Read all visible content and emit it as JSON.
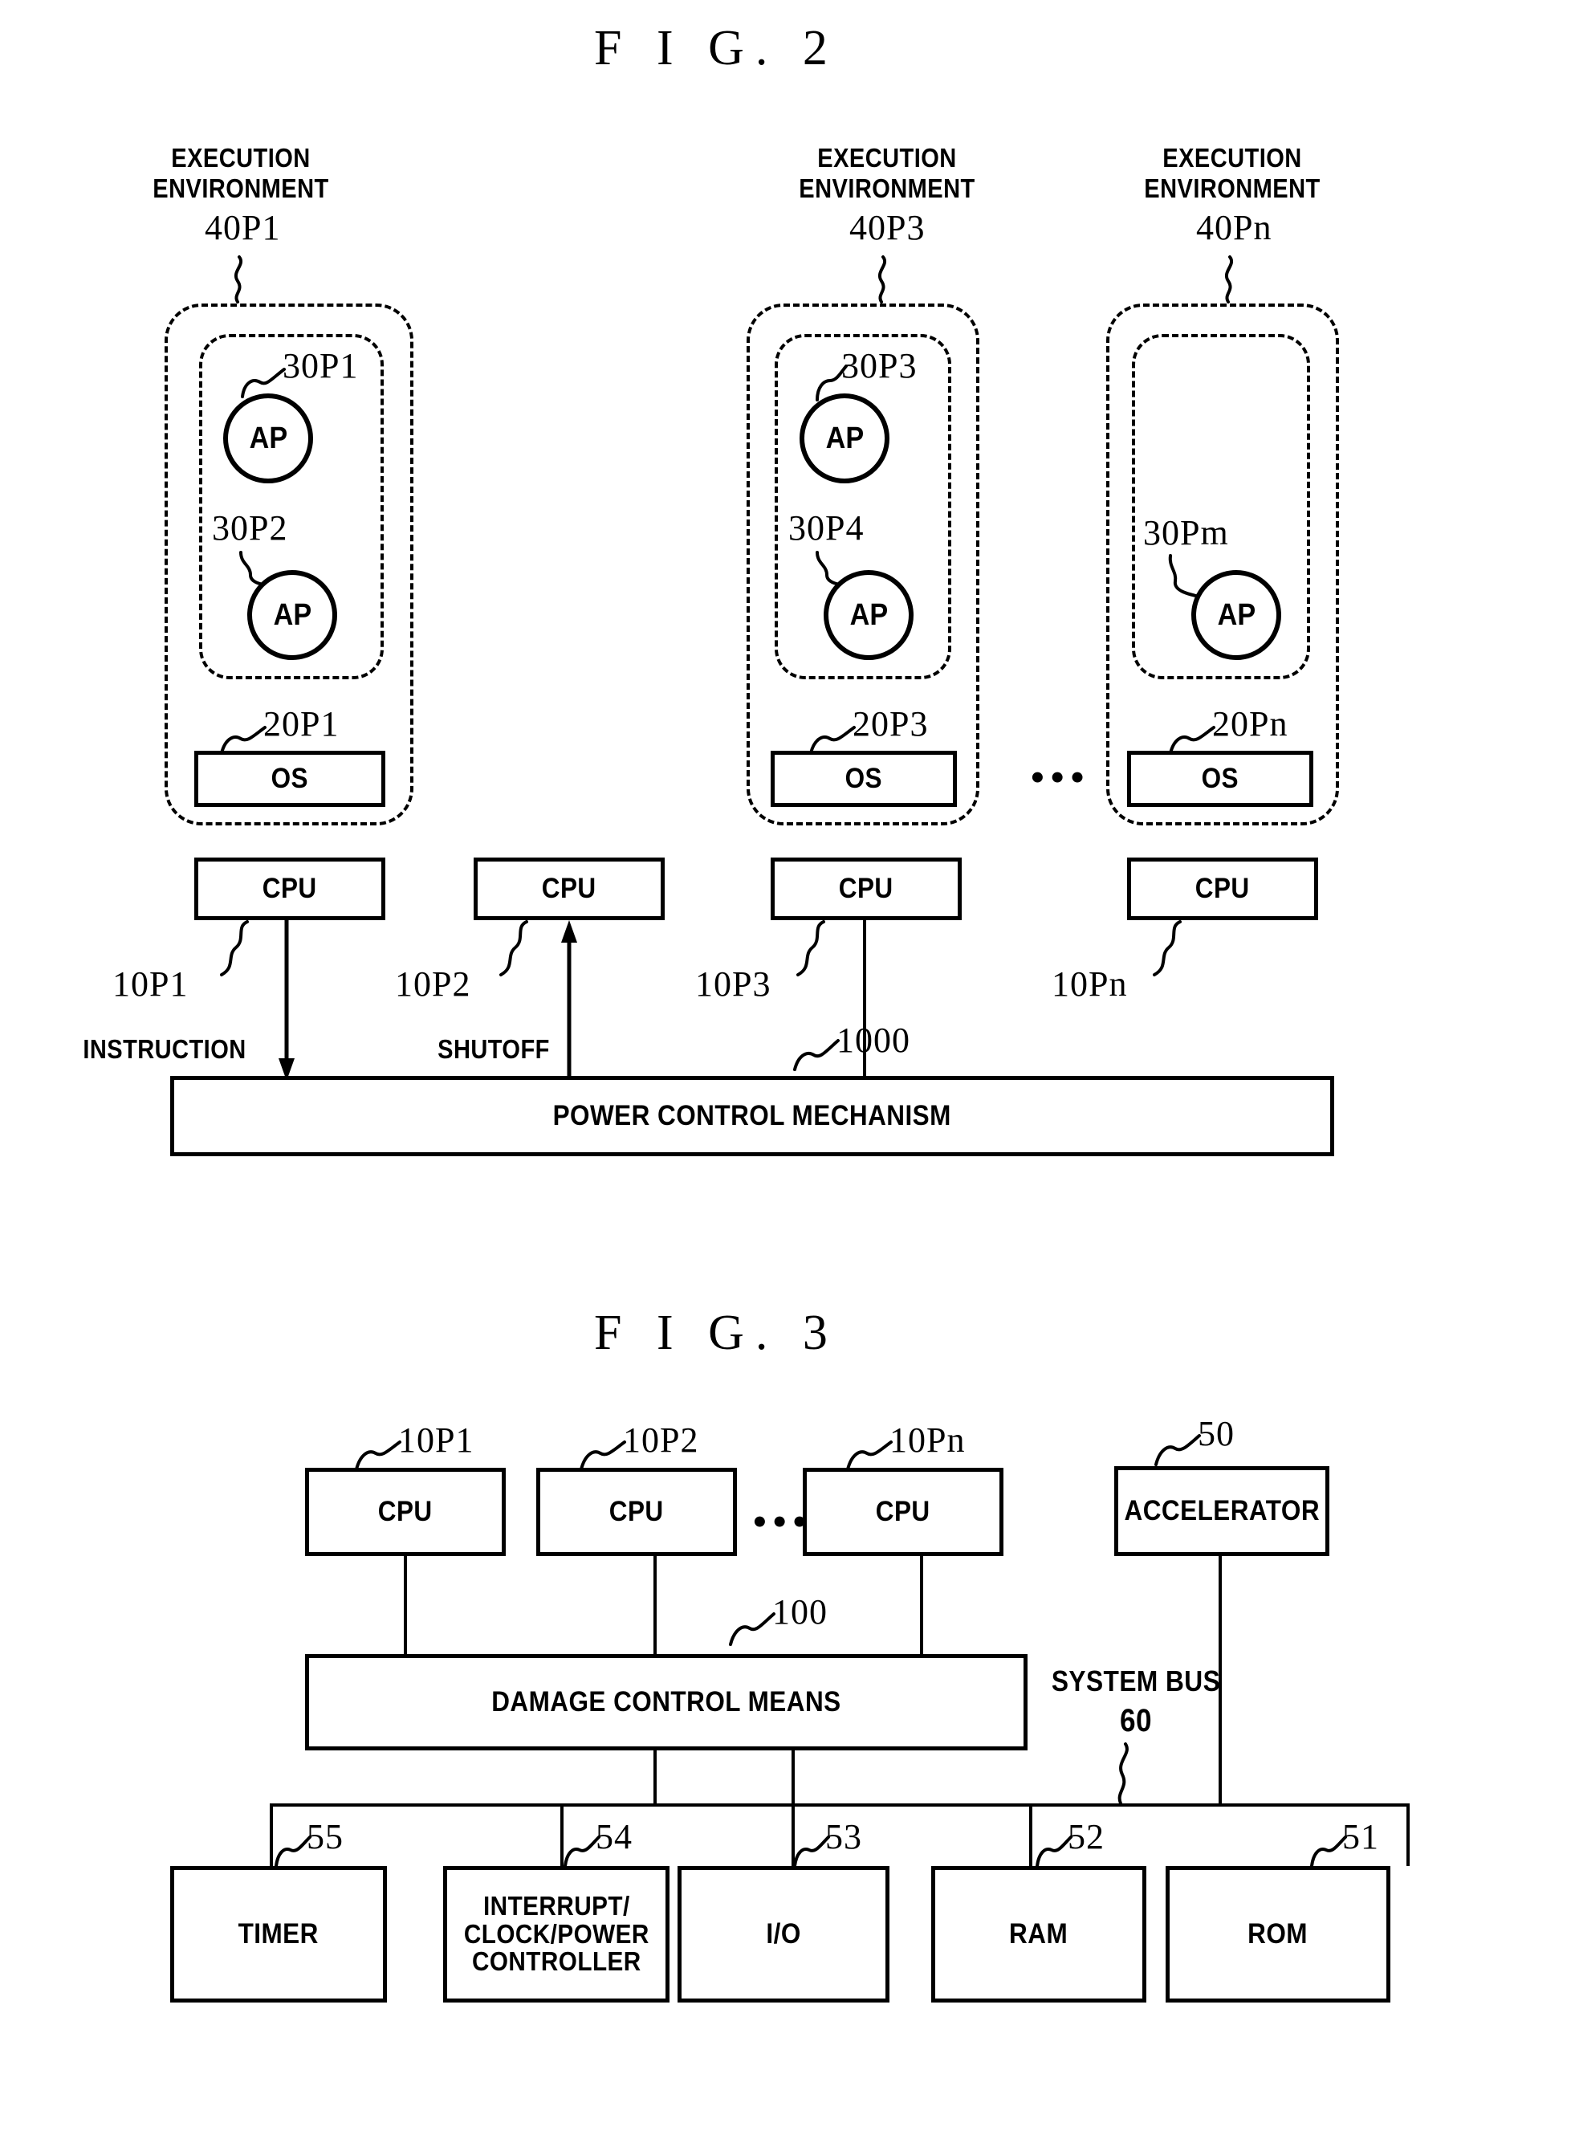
{
  "figures": {
    "fig2": {
      "title": "F I G. 2",
      "environments": [
        {
          "caption_line1": "EXECUTION",
          "caption_line2": "ENVIRONMENT",
          "caption_ref": "40P1",
          "apps": [
            {
              "label": "AP",
              "ref": "30P1"
            },
            {
              "label": "AP",
              "ref": "30P2"
            }
          ],
          "os": {
            "label": "OS",
            "ref": "20P1"
          }
        },
        {
          "caption_line1": "EXECUTION",
          "caption_line2": "ENVIRONMENT",
          "caption_ref": "40P3",
          "apps": [
            {
              "label": "AP",
              "ref": "30P3"
            },
            {
              "label": "AP",
              "ref": "30P4"
            }
          ],
          "os": {
            "label": "OS",
            "ref": "20P3"
          }
        },
        {
          "caption_line1": "EXECUTION",
          "caption_line2": "ENVIRONMENT",
          "caption_ref": "40Pn",
          "apps": [
            {
              "label": "AP",
              "ref": "30Pm"
            }
          ],
          "os": {
            "label": "OS",
            "ref": "20Pn"
          }
        }
      ],
      "cpus": [
        {
          "label": "CPU",
          "ref": "10P1"
        },
        {
          "label": "CPU",
          "ref": "10P2"
        },
        {
          "label": "CPU",
          "ref": "10P3"
        },
        {
          "label": "CPU",
          "ref": "10Pn"
        }
      ],
      "signals": {
        "instruction": "INSTRUCTION",
        "shutoff": "SHUTOFF"
      },
      "power_control": {
        "label": "POWER CONTROL MECHANISM",
        "ref": "1000"
      },
      "ellipsis": "•••"
    },
    "fig3": {
      "title": "F I G. 3",
      "cpus": [
        {
          "label": "CPU",
          "ref": "10P1"
        },
        {
          "label": "CPU",
          "ref": "10P2"
        },
        {
          "label": "CPU",
          "ref": "10Pn"
        }
      ],
      "accelerator": {
        "label": "ACCELERATOR",
        "ref": "50"
      },
      "damage_control": {
        "label": "DAMAGE CONTROL MEANS",
        "ref": "100"
      },
      "system_bus": {
        "label_line1": "SYSTEM BUS",
        "label_line2": "60"
      },
      "peripherals": [
        {
          "label": "TIMER",
          "ref": "55"
        },
        {
          "label": "INTERRUPT/\nCLOCK/POWER\nCONTROLLER",
          "ref": "54"
        },
        {
          "label": "I/O",
          "ref": "53"
        },
        {
          "label": "RAM",
          "ref": "52"
        },
        {
          "label": "ROM",
          "ref": "51"
        }
      ],
      "ellipsis": "•••"
    }
  },
  "colors": {
    "ink": "#000000",
    "paper": "#ffffff"
  }
}
